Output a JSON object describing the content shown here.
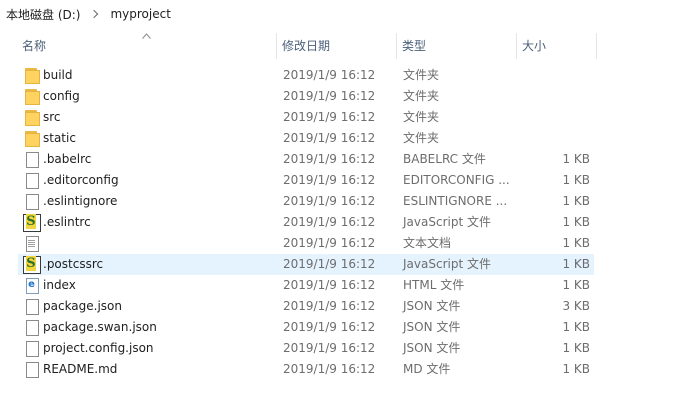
{
  "breadcrumb": {
    "items": [
      "本地磁盘 (D:)",
      "myproject"
    ]
  },
  "columns": {
    "name": "名称",
    "date": "修改日期",
    "type": "类型",
    "size": "大小"
  },
  "files": [
    {
      "name": "build",
      "date": "2019/1/9 16:12",
      "type": "文件夹",
      "size": "",
      "icon": "folder-icon"
    },
    {
      "name": "config",
      "date": "2019/1/9 16:12",
      "type": "文件夹",
      "size": "",
      "icon": "folder-icon"
    },
    {
      "name": "src",
      "date": "2019/1/9 16:12",
      "type": "文件夹",
      "size": "",
      "icon": "folder-icon"
    },
    {
      "name": "static",
      "date": "2019/1/9 16:12",
      "type": "文件夹",
      "size": "",
      "icon": "folder-icon"
    },
    {
      "name": ".babelrc",
      "date": "2019/1/9 16:12",
      "type": "BABELRC 文件",
      "size": "1 KB",
      "icon": "file-icon"
    },
    {
      "name": ".editorconfig",
      "date": "2019/1/9 16:12",
      "type": "EDITORCONFIG ...",
      "size": "1 KB",
      "icon": "file-icon"
    },
    {
      "name": ".eslintignore",
      "date": "2019/1/9 16:12",
      "type": "ESLINTIGNORE ...",
      "size": "1 KB",
      "icon": "file-icon"
    },
    {
      "name": ".eslintrc",
      "date": "2019/1/9 16:12",
      "type": "JavaScript 文件",
      "size": "1 KB",
      "icon": "javascript-file-icon"
    },
    {
      "name": "",
      "date": "2019/1/9 16:12",
      "type": "文本文档",
      "size": "1 KB",
      "icon": "text-document-icon"
    },
    {
      "name": ".postcssrc",
      "date": "2019/1/9 16:12",
      "type": "JavaScript 文件",
      "size": "1 KB",
      "icon": "javascript-file-icon"
    },
    {
      "name": "index",
      "date": "2019/1/9 16:12",
      "type": "HTML 文件",
      "size": "1 KB",
      "icon": "html-file-icon"
    },
    {
      "name": "package.json",
      "date": "2019/1/9 16:12",
      "type": "JSON 文件",
      "size": "3 KB",
      "icon": "file-icon"
    },
    {
      "name": "package.swan.json",
      "date": "2019/1/9 16:12",
      "type": "JSON 文件",
      "size": "1 KB",
      "icon": "file-icon"
    },
    {
      "name": "project.config.json",
      "date": "2019/1/9 16:12",
      "type": "JSON 文件",
      "size": "1 KB",
      "icon": "file-icon"
    },
    {
      "name": "README.md",
      "date": "2019/1/9 16:12",
      "type": "MD 文件",
      "size": "1 KB",
      "icon": "file-icon"
    }
  ],
  "hover_index": 9,
  "colors": {
    "hover_row": "#e5f3ff",
    "header_text": "#4c607a",
    "folder": "#ffd35f"
  }
}
